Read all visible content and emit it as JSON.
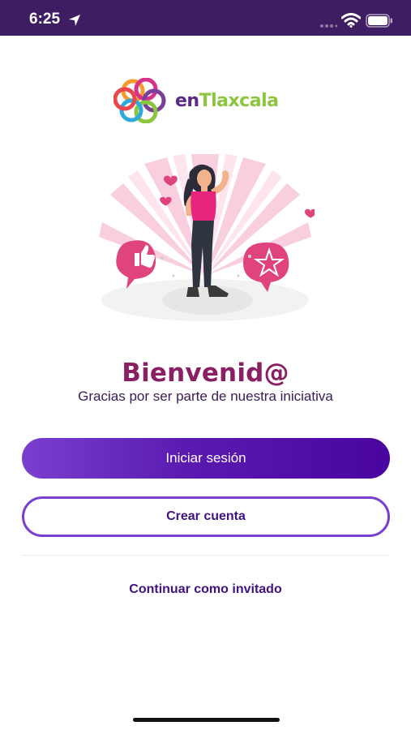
{
  "status_bar": {
    "time": "6:25",
    "icons": [
      "location-arrow-icon",
      "signal-icon",
      "wifi-icon",
      "battery-icon"
    ]
  },
  "logo": {
    "text_prefix": "en",
    "text_main": "Tlaxcala",
    "colors": {
      "prefix": "#5a2a86",
      "main": "#8cc63f"
    }
  },
  "illustration": {
    "name": "welcome-woman-illustration"
  },
  "welcome": {
    "title": "Bienvenid@",
    "subtitle": "Gracias por ser parte de nuestra iniciativa"
  },
  "actions": {
    "login_label": "Iniciar sesión",
    "register_label": "Crear cuenta",
    "guest_label": "Continuar como invitado"
  },
  "colors": {
    "status_bar": "#3f1d63",
    "accent": "#7b3fcf",
    "title": "#8a1f63",
    "link": "#3f1280"
  }
}
